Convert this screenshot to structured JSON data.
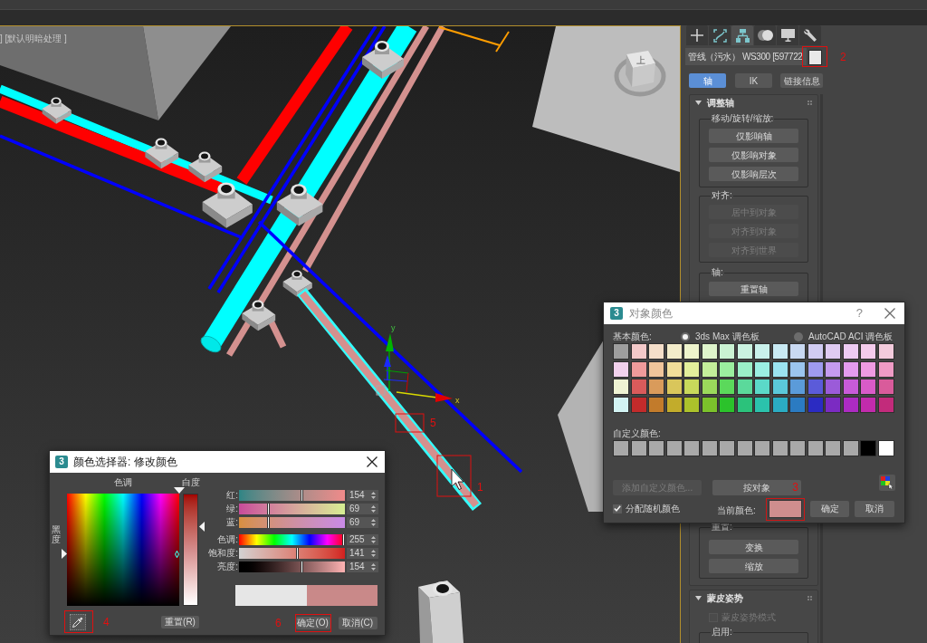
{
  "viewport": {
    "label": "] [默认明暗处理 ]",
    "view_cube_label": "上",
    "gizmo_axes": [
      {
        "label": "y"
      },
      {
        "label": "x"
      }
    ],
    "annotations": [
      {
        "number": "5"
      },
      {
        "number": "1"
      }
    ]
  },
  "command_panel": {
    "tabs": [
      {
        "selected": false
      },
      {
        "selected": false
      },
      {
        "selected": true
      },
      {
        "selected": false
      },
      {
        "selected": false
      },
      {
        "selected": false
      }
    ],
    "object_name": "管线（污水） WS300 [597722",
    "object_color": {
      "color": "#e9e9e9"
    },
    "annotation": {
      "number": "2"
    },
    "subtabs": [
      {
        "label": "轴",
        "selected": true
      },
      {
        "label": "IK",
        "selected": false
      },
      {
        "label": "链接信息",
        "selected": false
      }
    ],
    "rollouts": [
      {
        "title": "调整轴",
        "expanded": true,
        "groups": [
          {
            "label": "移动/旋转/缩放:",
            "buttons": [
              {
                "label": "仅影响轴",
                "disabled": false
              },
              {
                "label": "仅影响对象",
                "disabled": false
              },
              {
                "label": "仅影响层次",
                "disabled": false
              }
            ]
          },
          {
            "label": "对齐:",
            "buttons": [
              {
                "label": "居中到对象",
                "disabled": true
              },
              {
                "label": "对齐到对象",
                "disabled": true
              },
              {
                "label": "对齐到世界",
                "disabled": true
              }
            ]
          },
          {
            "label": "轴:",
            "buttons": [
              {
                "label": "重置轴",
                "disabled": false
              }
            ]
          }
        ]
      },
      {
        "groups": [
          {
            "label": "重置:",
            "buttons": [
              {
                "label": "变换",
                "disabled": false
              },
              {
                "label": "缩放",
                "disabled": false
              }
            ]
          }
        ]
      },
      {
        "title": "蒙皮姿势",
        "expanded": true,
        "checkbox": {
          "label": "蒙皮姿势模式",
          "checked": false,
          "disabled": true
        },
        "groups": [
          {
            "label": "启用:"
          }
        ]
      }
    ]
  },
  "object_color_dialog": {
    "icon_text": "3",
    "title": "对象颜色",
    "help": "?",
    "basic_label": "基本颜色:",
    "palettes": [
      {
        "label": "3ds Max 调色板",
        "selected": true
      },
      {
        "label": "AutoCAD ACI 调色板",
        "selected": false
      }
    ],
    "basic_colors": [
      {
        "color": "#9e9e9e"
      },
      {
        "color": "#f3c9c9"
      },
      {
        "color": "#f4dec9"
      },
      {
        "color": "#f3ecca"
      },
      {
        "color": "#eef4cc"
      },
      {
        "color": "#def4cb"
      },
      {
        "color": "#caf2d2"
      },
      {
        "color": "#caf2e0"
      },
      {
        "color": "#c9f1eb"
      },
      {
        "color": "#c9eaf3"
      },
      {
        "color": "#c9d9f2"
      },
      {
        "color": "#d1ccf2"
      },
      {
        "color": "#dfcbf2"
      },
      {
        "color": "#edcbf3"
      },
      {
        "color": "#f4cbec"
      },
      {
        "color": "#f3cbdc"
      },
      {
        "color": "#f2d1ed"
      },
      {
        "color": "#ef9b9b"
      },
      {
        "color": "#f0c59b"
      },
      {
        "color": "#f1de9a"
      },
      {
        "color": "#e3ef9b"
      },
      {
        "color": "#c4ef9a"
      },
      {
        "color": "#9bef9f"
      },
      {
        "color": "#9befc8"
      },
      {
        "color": "#9befe3"
      },
      {
        "color": "#9be3f0"
      },
      {
        "color": "#9bc5ef"
      },
      {
        "color": "#9f9bef"
      },
      {
        "color": "#c59bef"
      },
      {
        "color": "#e39bef"
      },
      {
        "color": "#ef9be3"
      },
      {
        "color": "#ef9bc5"
      },
      {
        "color": "#eff3d3"
      },
      {
        "color": "#d95b5b"
      },
      {
        "color": "#d99b5b"
      },
      {
        "color": "#d9c65b"
      },
      {
        "color": "#c8d95b"
      },
      {
        "color": "#9bd95b"
      },
      {
        "color": "#5bd95b"
      },
      {
        "color": "#5bd99b"
      },
      {
        "color": "#5bd9c8"
      },
      {
        "color": "#5bc8d9"
      },
      {
        "color": "#5b9bd9"
      },
      {
        "color": "#5b5bd9"
      },
      {
        "color": "#9b5bd9"
      },
      {
        "color": "#c85bd9"
      },
      {
        "color": "#d95bc8"
      },
      {
        "color": "#d95b9b"
      },
      {
        "color": "#d3f3f3"
      },
      {
        "color": "#c22b2b"
      },
      {
        "color": "#c27b2b"
      },
      {
        "color": "#c2ac2b"
      },
      {
        "color": "#acc22b"
      },
      {
        "color": "#7bc22b"
      },
      {
        "color": "#2bc22b"
      },
      {
        "color": "#2bc27b"
      },
      {
        "color": "#2bc2ac"
      },
      {
        "color": "#2bacc2"
      },
      {
        "color": "#2b7bc2"
      },
      {
        "color": "#2b2bc2"
      },
      {
        "color": "#7b2bc2"
      },
      {
        "color": "#ac2bc2"
      },
      {
        "color": "#c22bac"
      },
      {
        "color": "#c22b7b"
      }
    ],
    "custom_label": "自定义颜色:",
    "custom_colors": [
      {
        "color": "#a9a9a9"
      },
      {
        "color": "#a9a9a9"
      },
      {
        "color": "#a9a9a9"
      },
      {
        "color": "#a9a9a9"
      },
      {
        "color": "#a9a9a9"
      },
      {
        "color": "#a9a9a9"
      },
      {
        "color": "#a9a9a9"
      },
      {
        "color": "#a9a9a9"
      },
      {
        "color": "#a9a9a9"
      },
      {
        "color": "#a9a9a9"
      },
      {
        "color": "#a9a9a9"
      },
      {
        "color": "#a9a9a9"
      },
      {
        "color": "#a9a9a9"
      },
      {
        "color": "#a9a9a9"
      },
      {
        "color": "#000000"
      },
      {
        "color": "#ffffff"
      }
    ],
    "buttons": [
      {
        "label": "添加自定义颜色...",
        "disabled": true
      },
      {
        "label": "按对象",
        "disabled": false
      }
    ],
    "annotation": {
      "number": "3"
    },
    "random_color": {
      "label": "分配随机颜色",
      "checked": true
    },
    "current_color": {
      "label": "当前颜色:",
      "color": "#cf8e8e"
    },
    "actions": [
      {
        "label": "确定"
      },
      {
        "label": "取消"
      }
    ]
  },
  "color_selector_dialog": {
    "icon_text": "3",
    "title": "颜色选择器: 修改颜色",
    "hue_label": "色调",
    "whiteness_label": "白度",
    "blackness_label": "黑度",
    "hue_pointer": {
      "level": 1
    },
    "blackness_pointer": {
      "level": 0.54
    },
    "whiteness_pointer": {
      "level": 0.27
    },
    "rgb_sliders": [
      {
        "label": "红:",
        "value": "154",
        "level": 0.6
      },
      {
        "label": "绿:",
        "value": "69",
        "level": 0.27
      },
      {
        "label": "蓝:",
        "value": "69",
        "level": 0.27
      }
    ],
    "hsv_sliders": [
      {
        "label": "色调:",
        "value": "255",
        "level": 1
      },
      {
        "label": "饱和度:",
        "value": "141",
        "level": 0.55
      },
      {
        "label": "亮度:",
        "value": "154",
        "level": 0.6
      }
    ],
    "preview": [
      {
        "color": "#e6e6e6"
      },
      {
        "color": "#c98989"
      }
    ],
    "reset_button": "重置(R)",
    "ok_button": "确定(O)",
    "cancel_button": "取消(C)",
    "annotations": [
      {
        "number": "4"
      },
      {
        "number": "6"
      }
    ]
  }
}
